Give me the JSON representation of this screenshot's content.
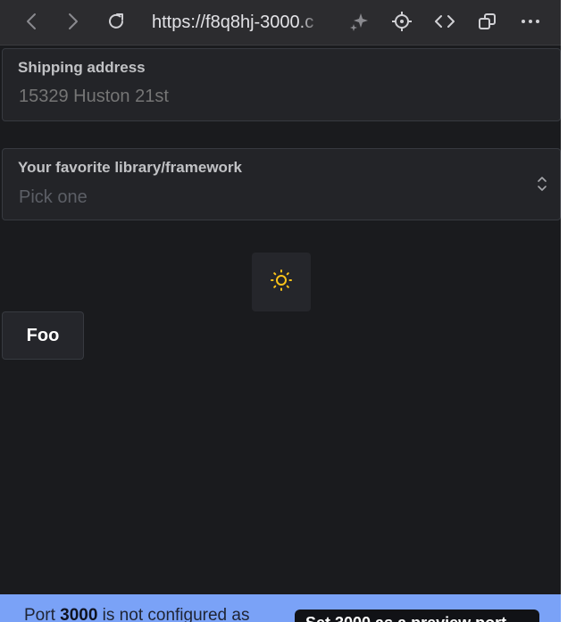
{
  "browser": {
    "url": "https://f8q8hj-3000.c",
    "icons": [
      "back-icon",
      "forward-icon",
      "reload-icon",
      "sparkle-icon",
      "crosshair-icon",
      "code-icon",
      "window-icon",
      "more-icon"
    ]
  },
  "form": {
    "shipping": {
      "label": "Shipping address",
      "placeholder": "15329 Huston 21st"
    },
    "library": {
      "label": "Your favorite library/framework",
      "placeholder": "Pick one"
    }
  },
  "theme_toggle": {
    "icon": "sun-icon",
    "color": "#fcc419"
  },
  "foo_button": {
    "label": "Foo"
  },
  "banner": {
    "prefix": "Port ",
    "port": "3000",
    "suffix": " is not configured as",
    "button_label": "Set 3000 as a preview port",
    "background": "#7aa2f7"
  }
}
